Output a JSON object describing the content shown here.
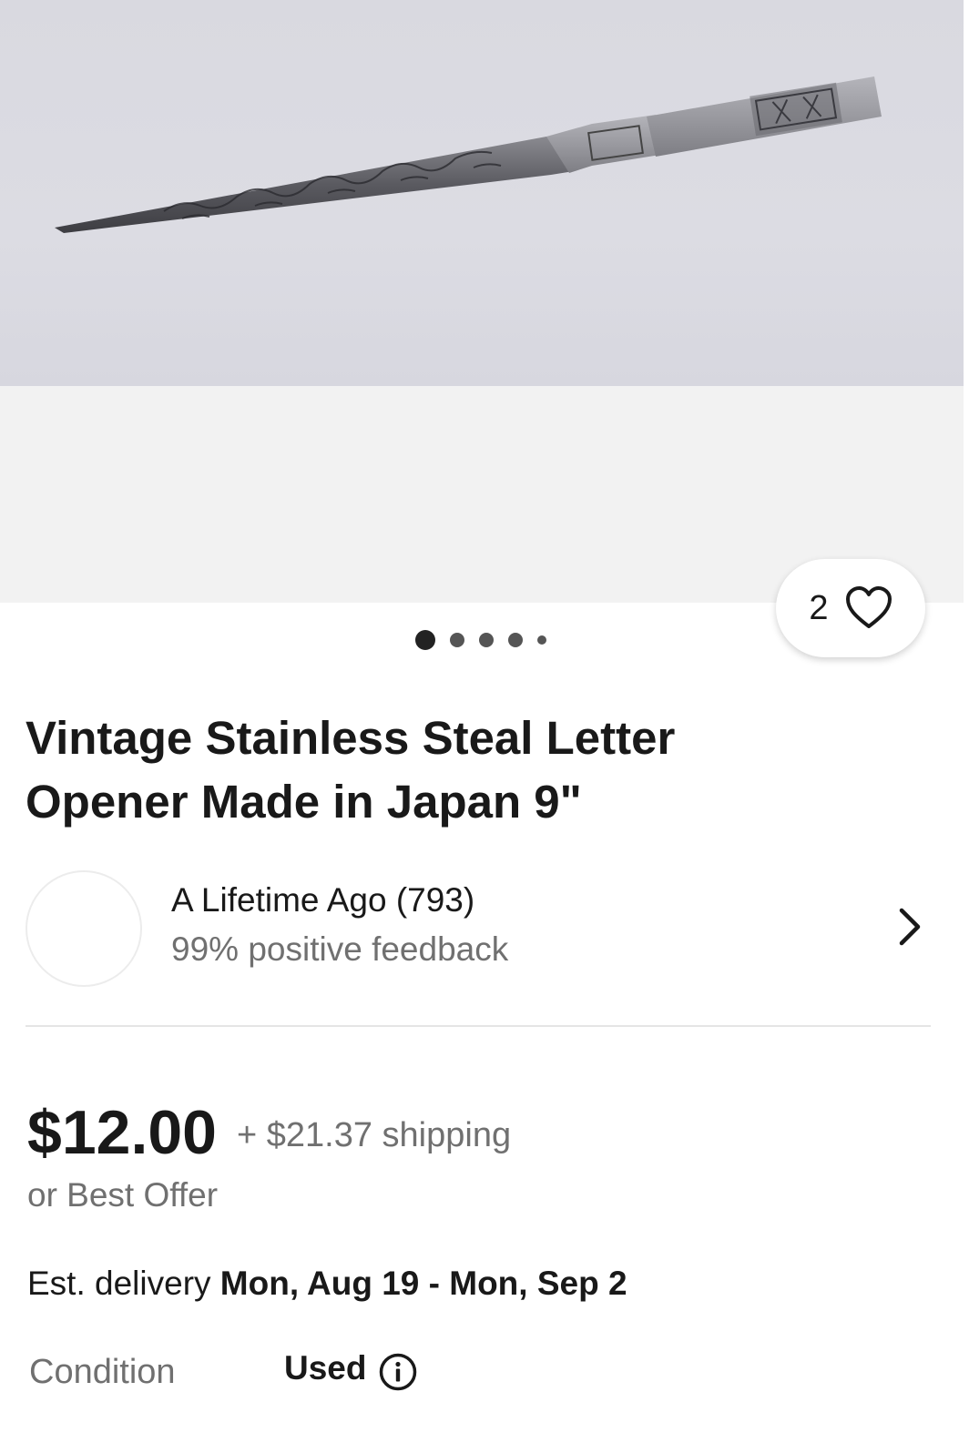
{
  "gallery": {
    "image_alt": "Vintage stainless steel letter opener with engraved floral blade",
    "watch_count": "2",
    "image_count": 5,
    "active_image_index": 0
  },
  "listing": {
    "title": "Vintage Stainless Steal Letter Opener Made in Japan 9\""
  },
  "seller": {
    "name": "A Lifetime Ago (793)",
    "feedback": "99% positive feedback"
  },
  "pricing": {
    "price": "$12.00",
    "shipping": "+ $21.37 shipping",
    "best_offer": "or Best Offer"
  },
  "delivery": {
    "label": "Est. delivery",
    "dates": "Mon, Aug 19 - Mon, Sep 2"
  },
  "condition": {
    "label": "Condition",
    "value": "Used"
  },
  "colors": {
    "text": "#191919",
    "secondary_text": "#707070",
    "gallery_bg": "#f2f2f2"
  },
  "icons": {
    "watch": "heart-icon",
    "seller_link": "chevron-right-icon",
    "condition_info": "info-icon"
  }
}
